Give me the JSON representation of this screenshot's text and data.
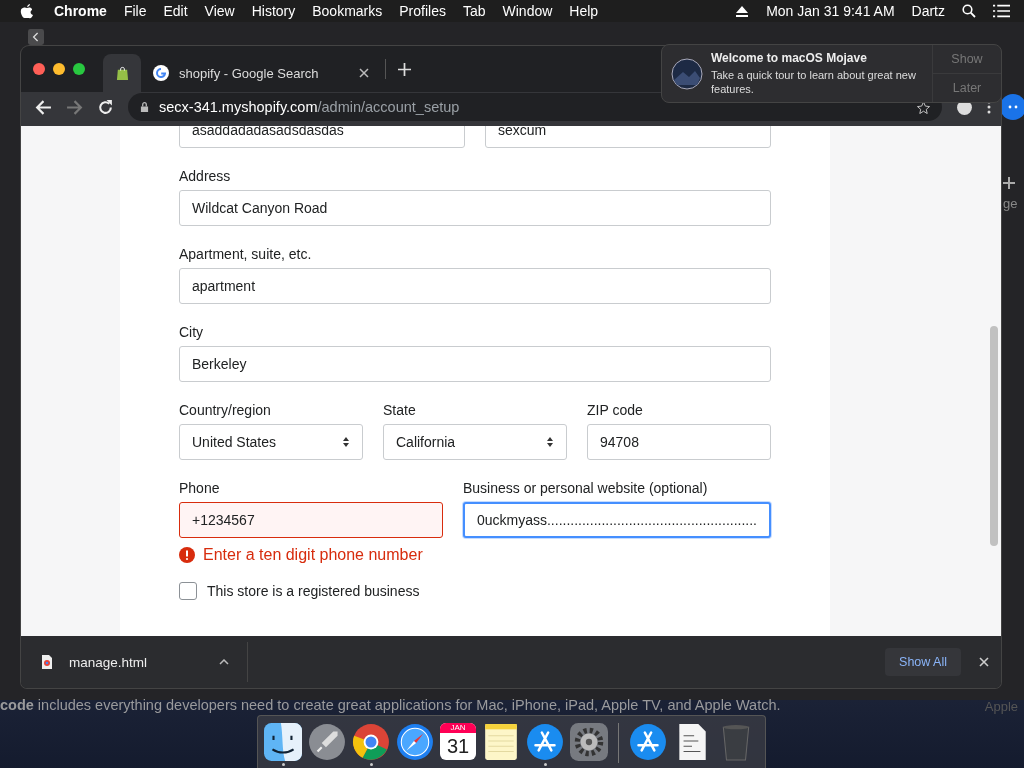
{
  "menubar": {
    "app": "Chrome",
    "menus": [
      "File",
      "Edit",
      "View",
      "History",
      "Bookmarks",
      "Profiles",
      "Tab",
      "Window",
      "Help"
    ],
    "clock": "Mon Jan 31  9:41 AM",
    "user": "Dartz"
  },
  "browser": {
    "tabs": [
      {
        "kind": "pinned",
        "selected": true
      },
      {
        "kind": "page",
        "title": "shopify - Google Search",
        "selected": false
      }
    ],
    "url": {
      "host": "secx-341.myshopify.com",
      "path": "/admin/account_setup"
    }
  },
  "form": {
    "top_fields": [
      {
        "value": "asaddadadasadsdasdas"
      },
      {
        "value": "sexcum"
      }
    ],
    "rows": [
      {
        "fields": [
          {
            "kind": "input",
            "label": "Address",
            "value": "Wildcat Canyon Road"
          }
        ]
      },
      {
        "fields": [
          {
            "kind": "input",
            "label": "Apartment, suite, etc.",
            "value": "apartment"
          }
        ]
      },
      {
        "fields": [
          {
            "kind": "input",
            "label": "City",
            "value": "Berkeley"
          }
        ]
      },
      {
        "fields": [
          {
            "kind": "select",
            "label": "Country/region",
            "value": "United States"
          },
          {
            "kind": "select",
            "label": "State",
            "value": "California"
          },
          {
            "kind": "input",
            "label": "ZIP code",
            "value": "94708"
          }
        ]
      },
      {
        "fields": [
          {
            "kind": "input",
            "label": "Phone",
            "value": "+1234567",
            "error": "Enter a ten digit phone number",
            "focused": false
          },
          {
            "kind": "input",
            "label": "Business or personal website (optional)",
            "value": "0uckmyass......................................................",
            "focused": true
          }
        ]
      }
    ],
    "checkbox": {
      "label": "This store is a registered business",
      "checked": false
    }
  },
  "downloads": {
    "file": "manage.html",
    "show_all": "Show All"
  },
  "notification": {
    "title": "Welcome to macOS Mojave",
    "body": "Take a quick tour to learn about great new features.",
    "actions": [
      "Show",
      "Later"
    ]
  },
  "background": {
    "caption": "**code** includes everything developers need to create great applications for Mac, iPhone, iPad, Apple TV, and Apple Watch.",
    "corner": "Apple",
    "side_label": "ge"
  },
  "dock": [
    {
      "kind": "finder",
      "running": true
    },
    {
      "kind": "rocket",
      "running": false
    },
    {
      "kind": "browser",
      "running": true
    },
    {
      "kind": "compass",
      "running": false
    },
    {
      "kind": "calendar",
      "month": "JAN",
      "day": "31",
      "running": false
    },
    {
      "kind": "notes",
      "running": false
    },
    {
      "kind": "store",
      "running": true
    },
    {
      "kind": "gear",
      "running": false
    },
    {
      "kind": "separator"
    },
    {
      "kind": "store",
      "running": false
    },
    {
      "kind": "document",
      "running": false
    },
    {
      "kind": "trash",
      "running": false
    }
  ]
}
